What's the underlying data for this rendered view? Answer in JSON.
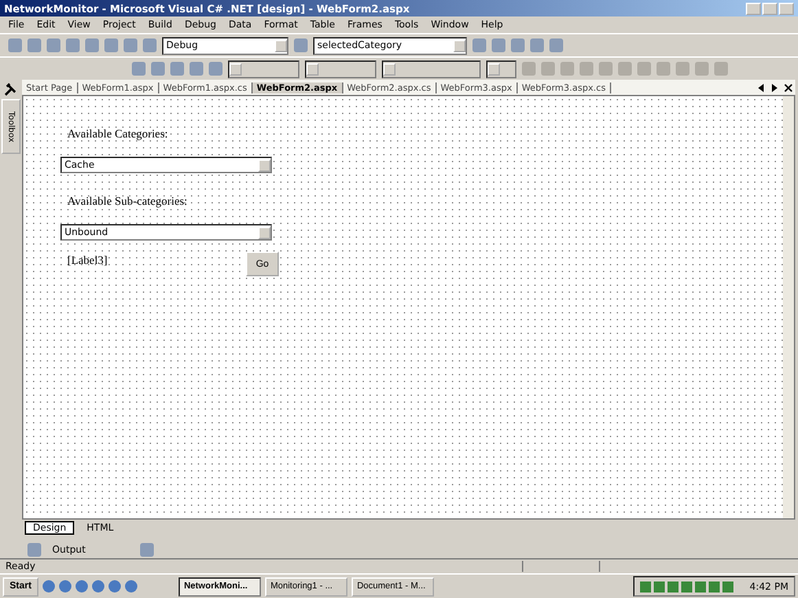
{
  "window": {
    "title": "NetworkMonitor - Microsoft Visual C# .NET [design] - WebForm2.aspx"
  },
  "menu": [
    "File",
    "Edit",
    "View",
    "Project",
    "Build",
    "Debug",
    "Data",
    "Format",
    "Table",
    "Frames",
    "Tools",
    "Window",
    "Help"
  ],
  "toolbar": {
    "configuration": "Debug",
    "find_combo": "selectedCategory"
  },
  "tabs": [
    {
      "label": "Start Page",
      "selected": false
    },
    {
      "label": "WebForm1.aspx",
      "selected": false
    },
    {
      "label": "WebForm1.aspx.cs",
      "selected": false
    },
    {
      "label": "WebForm2.aspx",
      "selected": true
    },
    {
      "label": "WebForm2.aspx.cs",
      "selected": false
    },
    {
      "label": "WebForm3.aspx",
      "selected": false
    },
    {
      "label": "WebForm3.aspx.cs",
      "selected": false
    }
  ],
  "sidebar": {
    "label": "Toolbox"
  },
  "form": {
    "controls": [
      {
        "kind": "label",
        "text": "Available Categories:"
      },
      {
        "kind": "dropdown",
        "value": "Cache"
      },
      {
        "kind": "label",
        "text": "Available Sub-categories:"
      },
      {
        "kind": "dropdown",
        "value": "Unbound"
      },
      {
        "kind": "label",
        "text": "[Label3]"
      },
      {
        "kind": "button",
        "text": "Go"
      }
    ]
  },
  "view_tabs": [
    {
      "label": "Design",
      "selected": true
    },
    {
      "label": "HTML",
      "selected": false
    }
  ],
  "output_panel": {
    "label": "Output"
  },
  "status_bar": {
    "text": "Ready"
  },
  "taskbar": {
    "start": "Start",
    "tasks": [
      {
        "label": "NetworkMoni...",
        "selected": true
      },
      {
        "label": "Monitoring1 - ...",
        "selected": false
      },
      {
        "label": "Document1 - M...",
        "selected": false
      }
    ],
    "clock": "4:42 PM"
  }
}
